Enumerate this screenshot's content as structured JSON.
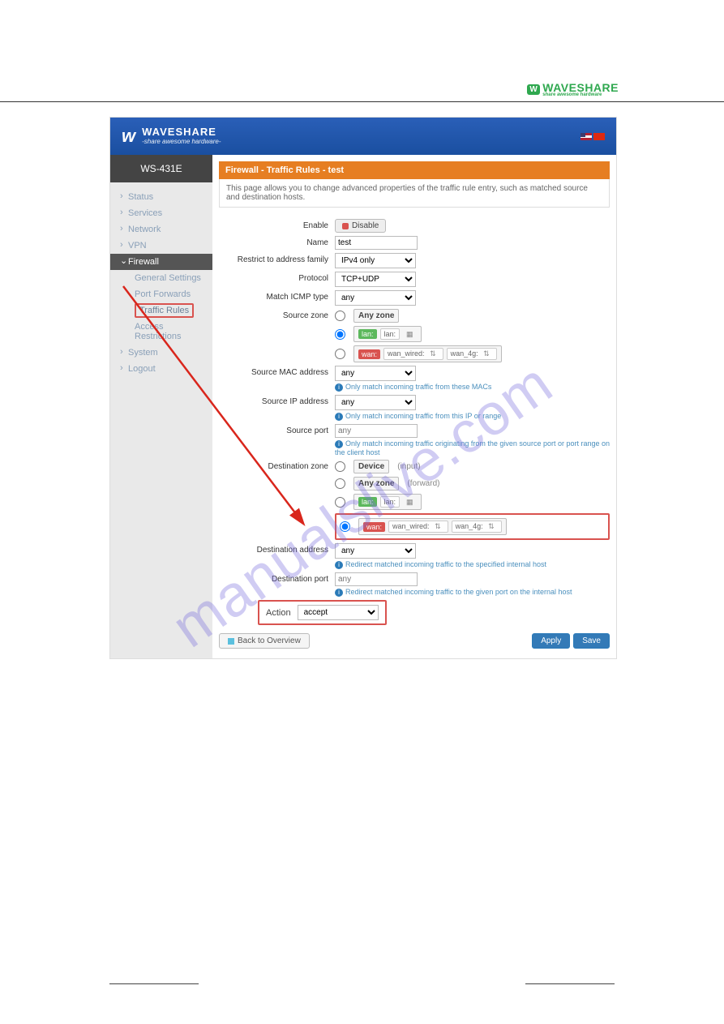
{
  "doc_logo": {
    "text": "WAVESHARE",
    "sub": "share awesome hardware"
  },
  "topbar": {
    "brand": "WAVESHARE",
    "tagline": "-share awesome hardware-"
  },
  "model": "WS-431E",
  "nav": [
    {
      "label": "Status"
    },
    {
      "label": "Services"
    },
    {
      "label": "Network"
    },
    {
      "label": "VPN"
    },
    {
      "label": "Firewall",
      "open": true,
      "children": [
        {
          "label": "General Settings"
        },
        {
          "label": "Port Forwards"
        },
        {
          "label": "Traffic Rules",
          "active": true
        },
        {
          "label": "Access Restrictions"
        }
      ]
    },
    {
      "label": "System"
    },
    {
      "label": "Logout"
    }
  ],
  "panel": {
    "title": "Firewall - Traffic Rules - test",
    "desc": "This page allows you to change advanced properties of the traffic rule entry, such as matched source and destination hosts."
  },
  "form": {
    "enable_btn": "Disable",
    "name": {
      "label": "Name",
      "value": "test"
    },
    "family": {
      "label": "Restrict to address family",
      "value": "IPv4 only"
    },
    "protocol": {
      "label": "Protocol",
      "value": "TCP+UDP"
    },
    "icmp": {
      "label": "Match ICMP type",
      "value": "any"
    },
    "src_zone": {
      "label": "Source zone",
      "any": "Any zone",
      "lan": "lan:",
      "lan_if": "lan:",
      "wan": "wan:",
      "wan_if1": "wan_wired:",
      "wan_if2": "wan_4g:"
    },
    "src_mac": {
      "label": "Source MAC address",
      "value": "any",
      "hint": "Only match incoming traffic from these MACs"
    },
    "src_ip": {
      "label": "Source IP address",
      "value": "any",
      "hint": "Only match incoming traffic from this IP or range"
    },
    "src_port": {
      "label": "Source port",
      "placeholder": "any",
      "hint": "Only match incoming traffic originating from the given source port or port range on the client host"
    },
    "dst_zone": {
      "label": "Destination zone",
      "device": "Device",
      "device_note": "(input)",
      "any": "Any zone",
      "any_note": "(forward)",
      "lan": "lan:",
      "lan_if": "lan:",
      "wan": "wan:",
      "wan_if1": "wan_wired:",
      "wan_if2": "wan_4g:"
    },
    "dst_addr": {
      "label": "Destination address",
      "value": "any",
      "hint": "Redirect matched incoming traffic to the specified internal host"
    },
    "dst_port": {
      "label": "Destination port",
      "placeholder": "any",
      "hint": "Redirect matched incoming traffic to the given port on the internal host"
    },
    "action": {
      "label": "Action",
      "value": "accept"
    }
  },
  "buttons": {
    "back": "Back to Overview",
    "apply": "Apply",
    "save": "Save"
  },
  "watermark": "manualslive.com"
}
